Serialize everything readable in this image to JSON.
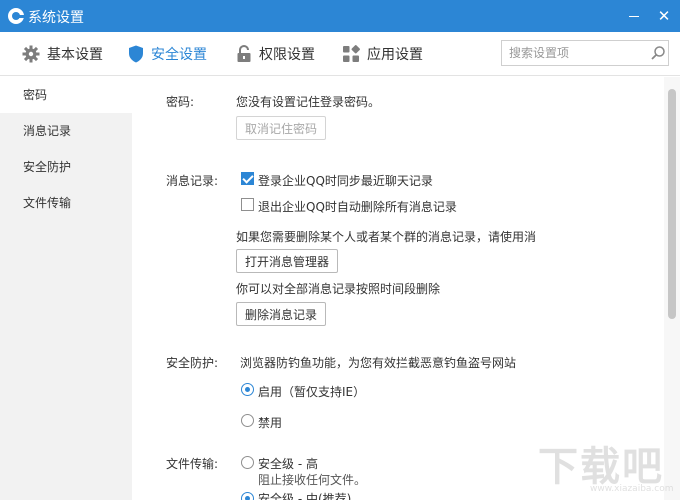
{
  "window": {
    "title": "系统设置",
    "minimize_glyph": "",
    "close_glyph": "✕"
  },
  "colors": {
    "accent": "#2c86d5",
    "titlebar": "#2c86d5",
    "sidebar_bg": "#f2f2f2"
  },
  "tabs": [
    {
      "label": "基本设置",
      "icon": "gear-icon",
      "active": false
    },
    {
      "label": "安全设置",
      "icon": "shield-icon",
      "active": true
    },
    {
      "label": "权限设置",
      "icon": "lock-icon",
      "active": false
    },
    {
      "label": "应用设置",
      "icon": "grid-icon",
      "active": false
    }
  ],
  "search": {
    "placeholder": "搜索设置项",
    "value": ""
  },
  "sidebar": {
    "items": [
      {
        "label": "密码",
        "active": true
      },
      {
        "label": "消息记录",
        "active": false
      },
      {
        "label": "安全防护",
        "active": false
      },
      {
        "label": "文件传输",
        "active": false
      }
    ]
  },
  "content": {
    "password": {
      "label": "密码:",
      "status": "您没有设置记住登录密码。",
      "clear_button": "取消记住密码"
    },
    "messages": {
      "label": "消息记录:",
      "sync_option": "登录企业QQ时同步最近聊天记录",
      "sync_checked": true,
      "delete_on_exit_option": "退出企业QQ时自动删除所有消息记录",
      "delete_on_exit_checked": false,
      "manager_hint": "如果您需要删除某个人或者某个群的消息记录，请使用消",
      "manager_button": "打开消息管理器",
      "delete_hint": "你可以对全部消息记录按照时间段删除",
      "delete_button": "删除消息记录"
    },
    "protection": {
      "label": "安全防护:",
      "description": "浏览器防钓鱼功能，为您有效拦截恶意钓鱼盗号网站",
      "enable_option": "启用（暂仅支持IE）",
      "enable_checked": true,
      "disable_option": "禁用",
      "disable_checked": false
    },
    "file_transfer": {
      "label": "文件传输:",
      "high_option": "安全级 - 高",
      "high_checked": false,
      "high_desc": "阻止接收任何文件。",
      "medium_option": "安全级 - 中(推荐)",
      "medium_checked": true
    }
  },
  "watermark": {
    "big": "下载吧",
    "small": "www.xiazaiba.com"
  }
}
